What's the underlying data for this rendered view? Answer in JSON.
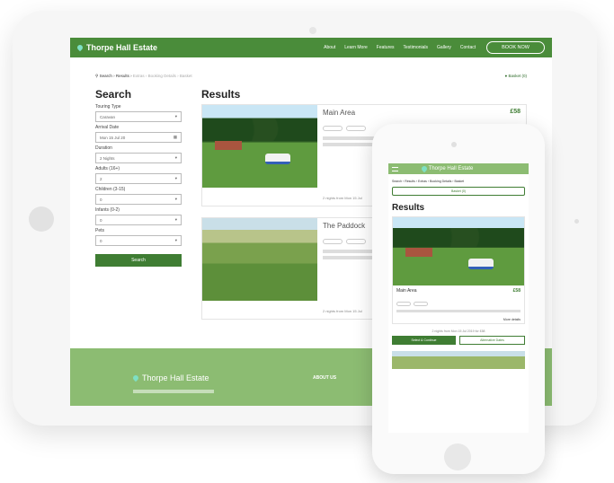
{
  "site": {
    "brand": "Thorpe Hall Estate",
    "nav": [
      "About",
      "Learn More",
      "Features",
      "Testimonials",
      "Gallery",
      "Contact"
    ],
    "book_label": "BOOK NOW"
  },
  "breadcrumb": {
    "search": "Search",
    "results": "Results",
    "rest": "Extras › Booking Details › Basket",
    "basket": "Basket (0)"
  },
  "search": {
    "title": "Search",
    "fields": [
      {
        "label": "Touring Type",
        "value": "Caravan"
      },
      {
        "label": "Arrival Date",
        "value": "Mon 15 Jul 20"
      },
      {
        "label": "Duration",
        "value": "2 Nights"
      },
      {
        "label": "Adults (16+)",
        "value": "2"
      },
      {
        "label": "Children (3-15)",
        "value": "0"
      },
      {
        "label": "Infants (0-2)",
        "value": "0"
      },
      {
        "label": "Pets",
        "value": "0"
      }
    ],
    "button": "Search"
  },
  "results": {
    "title": "Results",
    "items": [
      {
        "name": "Main Area",
        "price": "£58",
        "nights": "2 nights from Mon 15 Jul"
      },
      {
        "name": "The Paddock",
        "price": "",
        "nights": "2 nights from Mon 15 Jul"
      }
    ]
  },
  "footer": {
    "brand": "Thorpe Hall Estate",
    "about": "ABOUT US"
  },
  "mobile": {
    "brand": "Thorpe Hall Estate",
    "crumb": "Search › Results › Extras › Booking Details › Basket",
    "basket": "Basket (0)",
    "results_title": "Results",
    "item_name": "Main Area",
    "item_price": "£58",
    "more": "More details",
    "nights": "2 nights from Mon 15 Jul 2019 for £58",
    "select_btn": "Select & Continue",
    "alt_btn": "Alternative Dates"
  }
}
